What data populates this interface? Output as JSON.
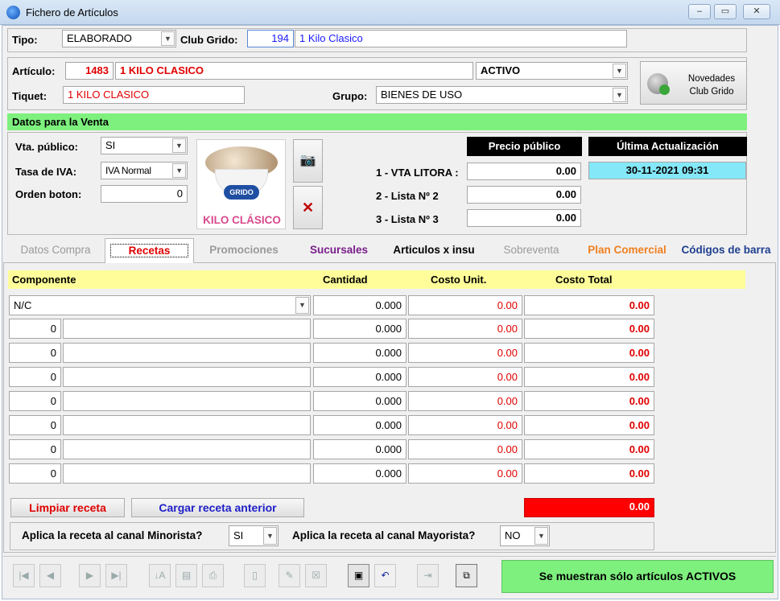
{
  "window": {
    "title": "Fichero de Artículos",
    "min": "–",
    "max": "▭",
    "close": "✕"
  },
  "header": {
    "tipo_label": "Tipo:",
    "tipo_value": "ELABORADO",
    "club_label": "Club Grido:",
    "club_code": "194",
    "club_name": "1 Kilo Clasico"
  },
  "articulo": {
    "label": "Artículo:",
    "code": "1483",
    "name": "1 KILO CLASICO",
    "estado": "ACTIVO",
    "tiquet_label": "Tiquet:",
    "tiquet_value": "1 KILO CLASICO",
    "grupo_label": "Grupo:",
    "grupo_value": "BIENES DE USO",
    "novedades_line1": "Novedades",
    "novedades_line2": "Club Grido"
  },
  "venta": {
    "section_title": "Datos para la Venta",
    "vta_publico_label": "Vta. público:",
    "vta_publico_value": "SI",
    "tasa_iva_label": "Tasa de IVA:",
    "tasa_iva_value": "IVA Normal",
    "orden_label": "Orden boton:",
    "orden_value": "0",
    "product_logo": "GRIDO",
    "product_caption": "KILO CLÁSICO",
    "precio_header": "Precio público",
    "actualizacion_header": "Última Actualización",
    "actualizacion_value": "30-11-2021 09:31",
    "listas": [
      {
        "label": "1 - VTA LITORA :",
        "value": "0.00"
      },
      {
        "label": "2 - Lista Nº 2",
        "value": "0.00"
      },
      {
        "label": "3 - Lista Nº 3",
        "value": "0.00"
      }
    ]
  },
  "tabs": [
    "Datos Compra",
    "Recetas",
    "Promociones",
    "Sucursales",
    "Articulos x insu",
    "Sobreventa",
    "Plan Comercial",
    "Códigos de barra"
  ],
  "recetas": {
    "columns": [
      "Componente",
      "Cantidad",
      "Costo Unit.",
      "Costo Total"
    ],
    "first_row": {
      "componente": "N/C",
      "cantidad": "0.000",
      "costo_unit": "0.00",
      "costo_total": "0.00"
    },
    "rows": [
      {
        "code": "0",
        "cantidad": "0.000",
        "costo_unit": "0.00",
        "costo_total": "0.00"
      },
      {
        "code": "0",
        "cantidad": "0.000",
        "costo_unit": "0.00",
        "costo_total": "0.00"
      },
      {
        "code": "0",
        "cantidad": "0.000",
        "costo_unit": "0.00",
        "costo_total": "0.00"
      },
      {
        "code": "0",
        "cantidad": "0.000",
        "costo_unit": "0.00",
        "costo_total": "0.00"
      },
      {
        "code": "0",
        "cantidad": "0.000",
        "costo_unit": "0.00",
        "costo_total": "0.00"
      },
      {
        "code": "0",
        "cantidad": "0.000",
        "costo_unit": "0.00",
        "costo_total": "0.00"
      },
      {
        "code": "0",
        "cantidad": "0.000",
        "costo_unit": "0.00",
        "costo_total": "0.00"
      }
    ],
    "limpiar_label": "Limpiar receta",
    "cargar_label": "Cargar receta anterior",
    "total": "0.00",
    "minorista_label": "Aplica la receta al canal Minorista?",
    "minorista_value": "SI",
    "mayorista_label": "Aplica la receta al canal Mayorista?",
    "mayorista_value": "NO"
  },
  "footer": {
    "status_label": "Se muestran sólo artículos ACTIVOS"
  },
  "colors": {
    "green": "#7ef07e",
    "yellow": "#fefd99",
    "red": "#ff0000",
    "cyan": "#85e8f8"
  }
}
